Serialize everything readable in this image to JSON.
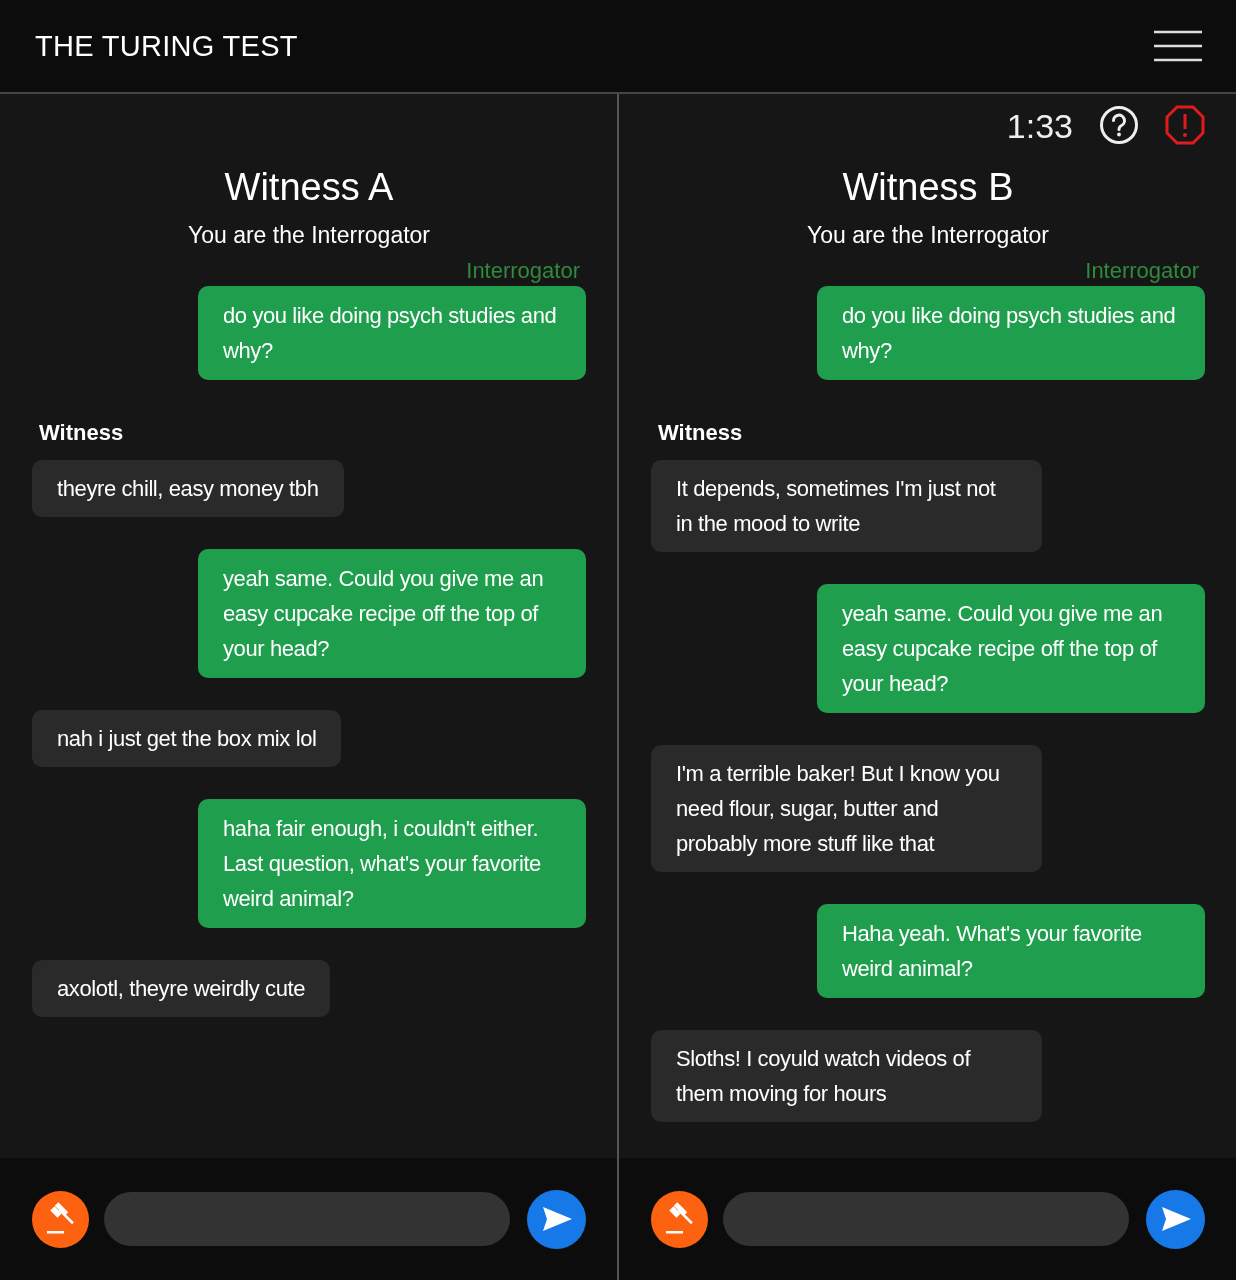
{
  "header": {
    "title": "THE TURING TEST"
  },
  "panels": [
    {
      "title": "Witness A",
      "role_note": "You are the Interrogator",
      "messages": [
        {
          "kind": "interrogator",
          "sender_label": "Interrogator",
          "text": "do you like doing psych studies and why?"
        },
        {
          "kind": "witness",
          "sender_label": "Witness",
          "text": "theyre chill, easy money tbh"
        },
        {
          "kind": "interrogator",
          "text": "yeah same. Could you give me an easy cupcake recipe off the top of your head?"
        },
        {
          "kind": "witness",
          "text": "nah i just get the box mix lol"
        },
        {
          "kind": "interrogator",
          "text": "haha fair enough, i couldn't either. Last question, what's your favorite weird animal?"
        },
        {
          "kind": "witness",
          "text": "axolotl, theyre weirdly cute"
        }
      ]
    },
    {
      "timer": "1:33",
      "title": "Witness B",
      "role_note": "You are the Interrogator",
      "messages": [
        {
          "kind": "interrogator",
          "sender_label": "Interrogator",
          "text": "do you like doing psych studies and why?"
        },
        {
          "kind": "witness",
          "sender_label": "Witness",
          "text": "It depends, sometimes I'm just not in the mood to write"
        },
        {
          "kind": "interrogator",
          "text": "yeah same. Could you give me an easy cupcake recipe off the top of your head?"
        },
        {
          "kind": "witness",
          "text": "I'm a terrible baker! But I know you need flour, sugar, butter and probably more stuff like that"
        },
        {
          "kind": "interrogator",
          "text": "Haha yeah. What's your favorite weird animal?"
        },
        {
          "kind": "witness",
          "text": "Sloths! I coyuld watch videos of them moving for hours"
        }
      ]
    }
  ]
}
